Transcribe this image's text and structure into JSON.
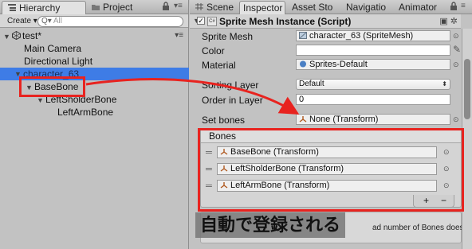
{
  "hierarchy": {
    "tabs": [
      {
        "label": "Hierarchy"
      },
      {
        "label": "Project"
      }
    ],
    "create_label": "Create ▾",
    "search_placeholder": "All",
    "scene_name": "test*",
    "items": [
      {
        "label": "Main Camera"
      },
      {
        "label": "Directional Light"
      },
      {
        "label": "character_63"
      },
      {
        "label": "BaseBone"
      },
      {
        "label": "LeftSholderBone"
      },
      {
        "label": "LeftArmBone"
      }
    ]
  },
  "inspector": {
    "tabs": [
      {
        "label": "Scene"
      },
      {
        "label": "Inspector"
      },
      {
        "label": "Asset Sto"
      },
      {
        "label": "Navigatio"
      },
      {
        "label": "Animator"
      }
    ],
    "component_title": "Sprite Mesh Instance (Script)",
    "properties": {
      "sprite_mesh": {
        "label": "Sprite Mesh",
        "value": "character_63 (SpriteMesh)"
      },
      "color": {
        "label": "Color",
        "value": ""
      },
      "material": {
        "label": "Material",
        "value": "Sprites-Default"
      },
      "sorting_layer": {
        "label": "Sorting Layer",
        "value": "Default"
      },
      "order_in_layer": {
        "label": "Order in Layer",
        "value": "0"
      },
      "set_bones": {
        "label": "Set bones",
        "value": "None (Transform)"
      }
    },
    "bones": {
      "header": "Bones",
      "items": [
        {
          "value": "BaseBone (Transform)"
        },
        {
          "value": "LeftSholderBone (Transform)"
        },
        {
          "value": "LeftArmBone (Transform)"
        }
      ],
      "plus": "+",
      "minus": "−"
    },
    "help_text": "ad number of Bones does"
  },
  "annotation": {
    "callout": "自動で登録される",
    "color": "#e8231f"
  },
  "colors": {
    "selection": "#3e7ce6",
    "panel": "#c2c2c2"
  }
}
